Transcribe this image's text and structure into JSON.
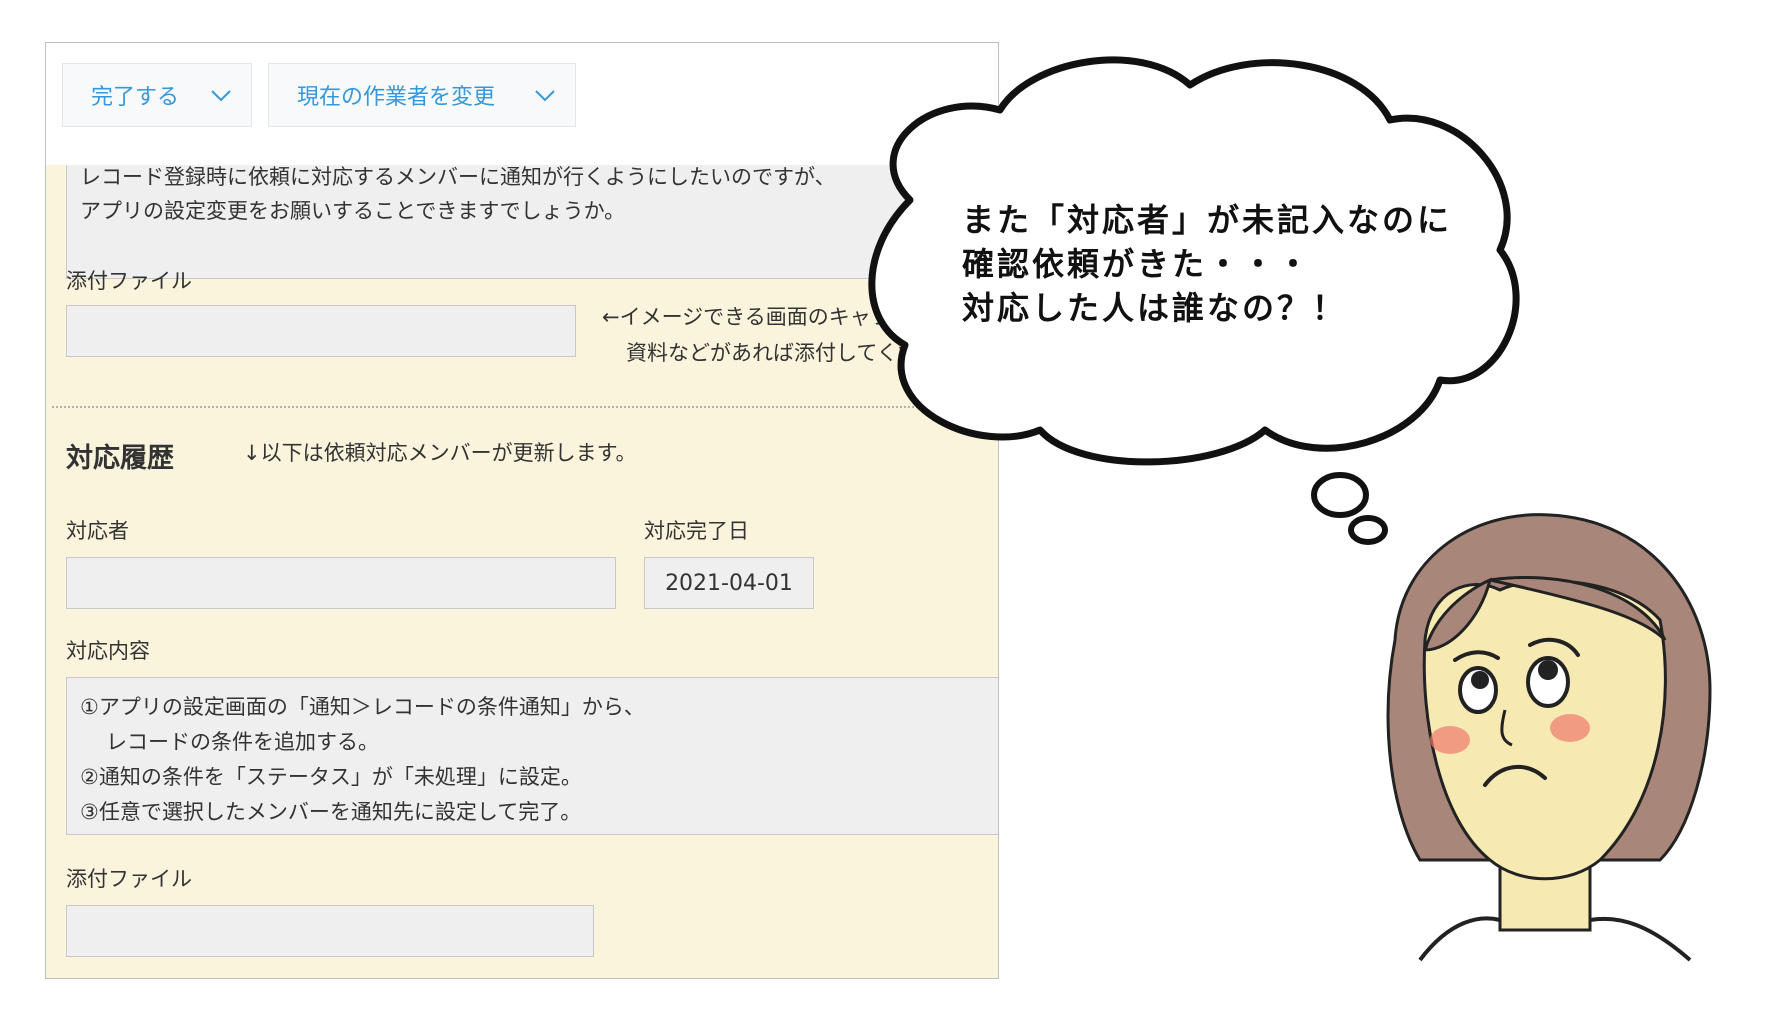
{
  "toolbar": {
    "complete_label": "完了する",
    "change_assignee_label": "現在の作業者を変更"
  },
  "request": {
    "content_lines": [
      "レコード登録時に依頼に対応するメンバーに通知が行くようにしたいのですが、",
      "アプリの設定変更をお願いすることできますでしょうか。"
    ],
    "attachment_label": "添付ファイル",
    "attachment_hint_lines": [
      "←イメージできる画面のキャプチャや",
      "資料などがあれば添付してください。"
    ]
  },
  "history": {
    "title": "対応履歴",
    "note": "↓以下は依頼対応メンバーが更新します。",
    "responder_label": "対応者",
    "responder_value": "",
    "completion_date_label": "対応完了日",
    "completion_date_value": "2021-04-01",
    "details_label": "対応内容",
    "details_lines": [
      "①アプリの設定画面の「通知＞レコードの条件通知」から、",
      "レコードの条件を追加する。",
      "②通知の条件を「ステータス」が「未処理」に設定。",
      "③任意で選択したメンバーを通知先に設定して完了。"
    ],
    "attachment_label": "添付ファイル"
  },
  "thought": {
    "lines": [
      "また「対応者」が未記入なのに",
      "確認依頼がきた・・・",
      "対応した人は誰なの？！"
    ]
  },
  "icons": {
    "chevron": "chevron-down-icon"
  },
  "colors": {
    "form_background": "#fbf4dc",
    "button_text": "#3498db",
    "field_background": "#efefef",
    "hair": "#a8877a",
    "skin": "#f6eab2",
    "cheek": "#f07a6e"
  }
}
